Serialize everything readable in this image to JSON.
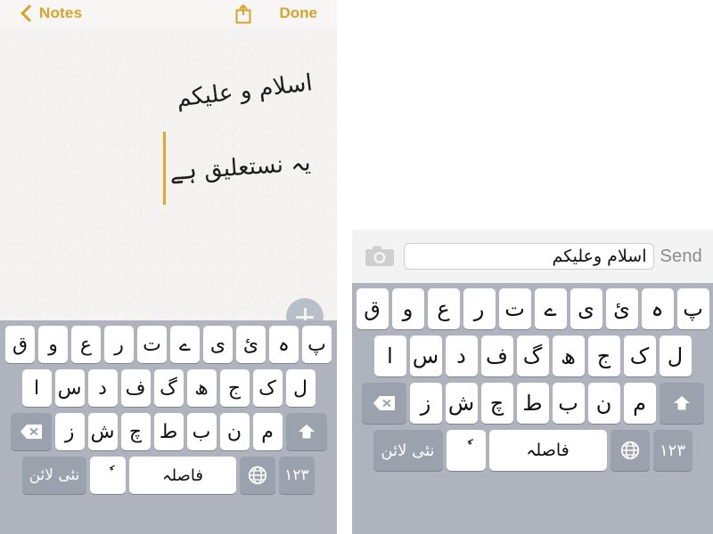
{
  "colors": {
    "accent_gold": "#d6a42b",
    "caret_gold": "#e0a72b",
    "keyboard_bg": "#aeb3bd",
    "key_white": "#ffffff",
    "key_dark": "#9ba1ad",
    "note_paper": "#f4f3f1",
    "send_gray": "#8b8b8b",
    "add_button_gray": "#b8bfc6"
  },
  "notes_app": {
    "nav": {
      "back_label": "Notes",
      "back_icon": "chevron-left-icon",
      "share_icon": "share-icon",
      "done_label": "Done"
    },
    "note": {
      "line_1": "اسلام و علیکم",
      "line_2": "یہ نستعلیق ہے"
    },
    "add_button_icon": "plus-icon"
  },
  "message_app": {
    "camera_icon": "camera-icon",
    "input_value": "اسلام وعلیکم",
    "input_placeholder": "",
    "send_label": "Send"
  },
  "keyboard": {
    "language": "Urdu",
    "rows": [
      {
        "name": "row-1",
        "keys": [
          {
            "label": "پ",
            "type": "letter"
          },
          {
            "label": "ہ",
            "type": "letter"
          },
          {
            "label": "ئ",
            "type": "letter"
          },
          {
            "label": "ی",
            "type": "letter"
          },
          {
            "label": "ے",
            "type": "letter"
          },
          {
            "label": "ت",
            "type": "letter"
          },
          {
            "label": "ر",
            "type": "letter"
          },
          {
            "label": "ع",
            "type": "letter"
          },
          {
            "label": "و",
            "type": "letter"
          },
          {
            "label": "ق",
            "type": "letter"
          }
        ]
      },
      {
        "name": "row-2",
        "keys": [
          {
            "label": "ل",
            "type": "letter"
          },
          {
            "label": "ک",
            "type": "letter"
          },
          {
            "label": "ج",
            "type": "letter"
          },
          {
            "label": "ھ",
            "type": "letter"
          },
          {
            "label": "گ",
            "type": "letter"
          },
          {
            "label": "ف",
            "type": "letter"
          },
          {
            "label": "د",
            "type": "letter"
          },
          {
            "label": "س",
            "type": "letter"
          },
          {
            "label": "ا",
            "type": "letter"
          }
        ]
      },
      {
        "name": "row-3",
        "keys": [
          {
            "label": "",
            "type": "shift",
            "icon": "shift-arrow-up-icon"
          },
          {
            "label": "م",
            "type": "letter"
          },
          {
            "label": "ن",
            "type": "letter"
          },
          {
            "label": "ب",
            "type": "letter"
          },
          {
            "label": "ط",
            "type": "letter"
          },
          {
            "label": "چ",
            "type": "letter"
          },
          {
            "label": "ش",
            "type": "letter"
          },
          {
            "label": "ز",
            "type": "letter"
          },
          {
            "label": "",
            "type": "delete",
            "icon": "backspace-icon"
          }
        ]
      },
      {
        "name": "row-4",
        "keys": [
          {
            "label": "۱۲۳",
            "type": "numeric"
          },
          {
            "label": "",
            "type": "globe",
            "icon": "globe-icon"
          },
          {
            "label": "فاصلہ",
            "type": "space"
          },
          {
            "label": "ٗ",
            "type": "diacritic"
          },
          {
            "label": "نئی لائن",
            "type": "return"
          }
        ]
      }
    ]
  }
}
